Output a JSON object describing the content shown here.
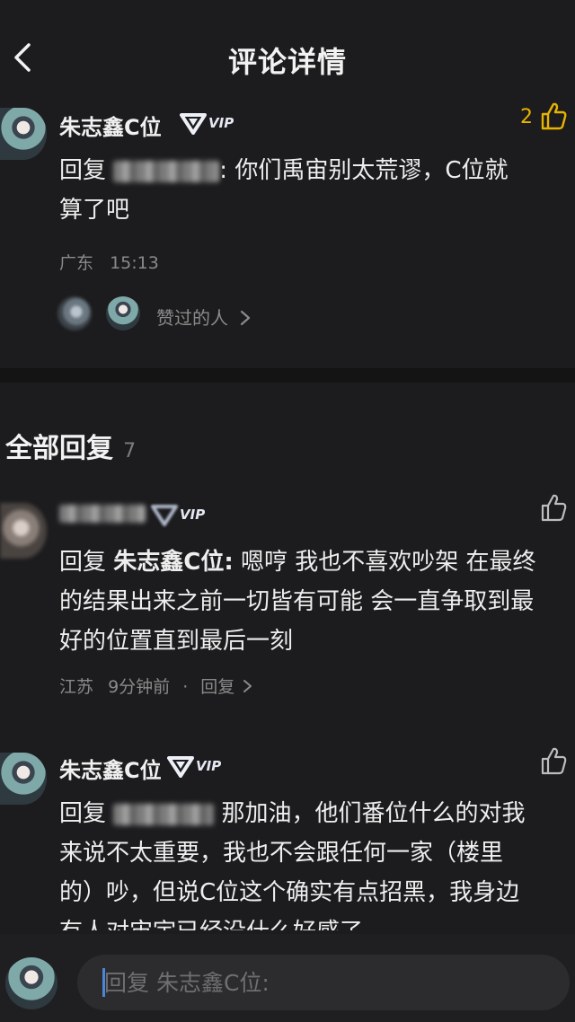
{
  "header": {
    "title": "评论详情"
  },
  "main_comment": {
    "username": "朱志鑫C位",
    "vip_label": "VIP",
    "like_count": "2",
    "reply_prefix": "回复",
    "reply_colon": ":",
    "text_line1": "你们禹宙别太荒谬，C位就",
    "text_line2": "算了吧",
    "location": "广东",
    "time": "15:13",
    "likers_label": "赞过的人"
  },
  "replies_section": {
    "title": "全部回复",
    "count": "7"
  },
  "replies": [
    {
      "vip_label": "VIP",
      "reply_prefix": "回复",
      "reply_to": "朱志鑫C位:",
      "lines": [
        "嗯哼 我也不喜欢吵架 在最终",
        "的结果出来之前一切皆有可能 会一直争取到最",
        "好的位置直到最后一刻"
      ],
      "location": "江苏",
      "time": "9分钟前",
      "separator": "·",
      "reply_label": "回复"
    },
    {
      "username": "朱志鑫C位",
      "vip_label": "VIP",
      "reply_prefix": "回复",
      "lines": [
        "那加油，他们番位什么的对我",
        "来说不太重要，我也不会跟任何一家（楼里",
        "的）吵，但说C位这个确实有点招黑，我身边",
        "有人对宙宇已经没什么好感了"
      ]
    }
  ],
  "bottom_bar": {
    "placeholder": "回复 朱志鑫C位:"
  },
  "colors": {
    "background": "#1c1c1e",
    "like_active": "#e8b300",
    "caret": "#4a86d9"
  }
}
